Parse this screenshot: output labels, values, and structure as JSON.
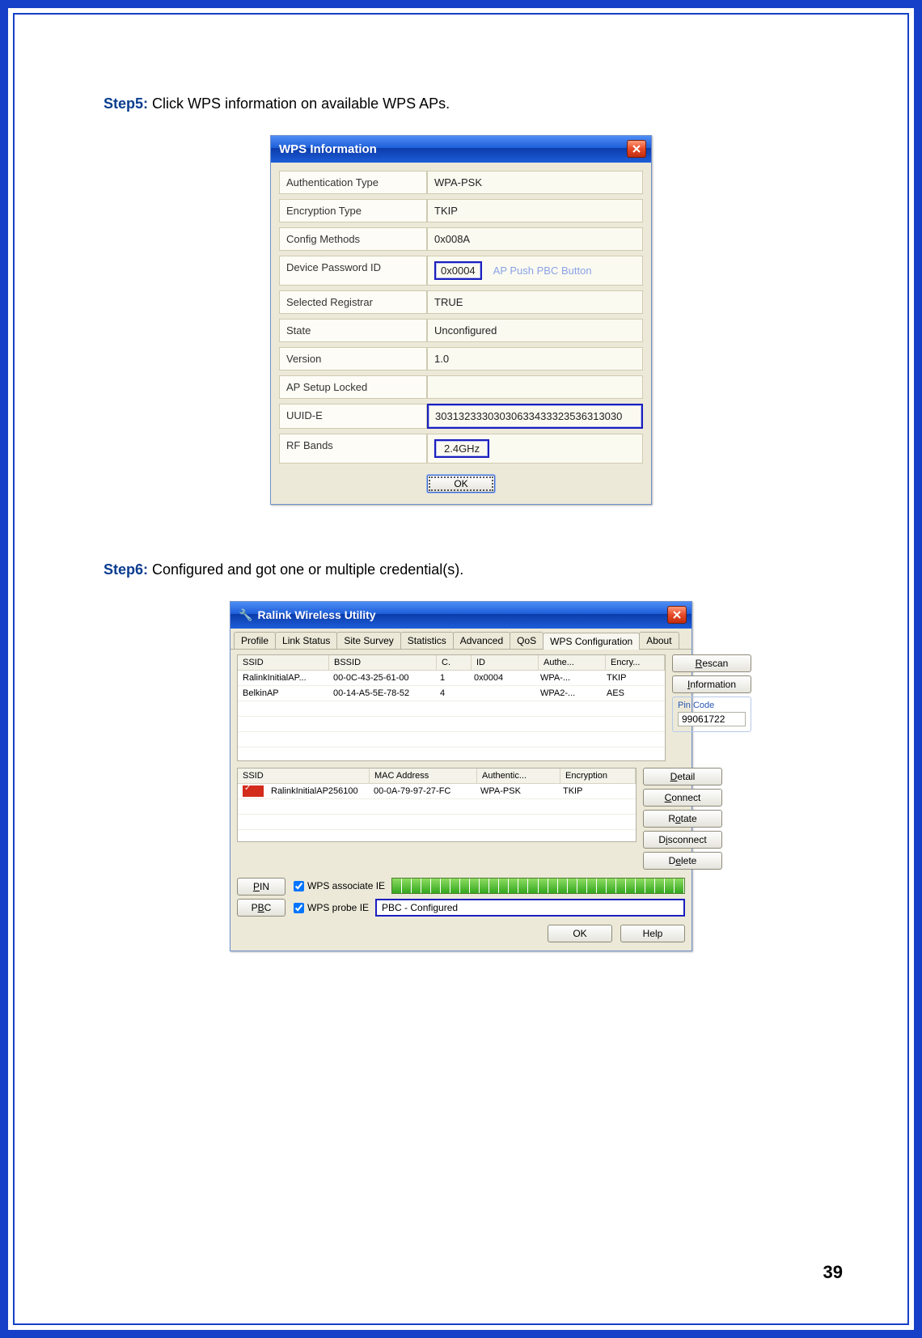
{
  "page_number": "39",
  "step5": {
    "label": "Step5:",
    "text": " Click WPS information on available WPS APs."
  },
  "step6": {
    "label": "Step6:",
    "text": " Configured and got one or multiple credential(s)."
  },
  "dlg1": {
    "title": "WPS Information",
    "rows": [
      {
        "label": "Authentication Type",
        "value": "WPA-PSK"
      },
      {
        "label": "Encryption Type",
        "value": "TKIP"
      },
      {
        "label": "Config Methods",
        "value": "0x008A"
      },
      {
        "label": "Device Password ID",
        "value": "0x0004",
        "hint": "AP Push PBC Button",
        "hl": true
      },
      {
        "label": "Selected Registrar",
        "value": "TRUE"
      },
      {
        "label": "State",
        "value": "Unconfigured"
      },
      {
        "label": "Version",
        "value": "1.0"
      },
      {
        "label": "AP Setup Locked",
        "value": ""
      },
      {
        "label": "UUID-E",
        "value": "30313233303030633433323536313030",
        "hl": true
      },
      {
        "label": "RF Bands",
        "value": "2.4GHz",
        "hl": true
      }
    ],
    "ok": "OK"
  },
  "dlg2": {
    "title": "Ralink Wireless Utility",
    "tabs": [
      "Profile",
      "Link Status",
      "Site Survey",
      "Statistics",
      "Advanced",
      "QoS",
      "WPS Configuration",
      "About"
    ],
    "active_tab": 6,
    "table1": {
      "headers": [
        "SSID",
        "BSSID",
        "C.",
        "ID",
        "Authe...",
        "Encry..."
      ],
      "rows": [
        {
          "ssid": "RalinkInitialAP...",
          "bssid": "00-0C-43-25-61-00",
          "c": "1",
          "id": "0x0004",
          "auth": "WPA-...",
          "enc": "TKIP"
        },
        {
          "ssid": "BelkinAP",
          "bssid": "00-14-A5-5E-78-52",
          "c": "4",
          "id": "",
          "auth": "WPA2-...",
          "enc": "AES"
        }
      ]
    },
    "table2": {
      "headers": [
        "SSID",
        "MAC Address",
        "Authentic...",
        "Encryption"
      ],
      "rows": [
        {
          "ssid": "RalinkInitialAP256100",
          "mac": "00-0A-79-97-27-FC",
          "auth": "WPA-PSK",
          "enc": "TKIP"
        }
      ]
    },
    "side": {
      "rescan": "Rescan",
      "info": "Information",
      "pin_label": "Pin Code",
      "pin_value": "99061722",
      "detail": "Detail",
      "connect": "Connect",
      "rotate": "Rotate",
      "disconnect": "Disconnect",
      "delete": "Delete"
    },
    "pin_btn": "PIN",
    "pbc_btn": "PBC",
    "assoc": "WPS associate IE",
    "probe": "WPS probe IE",
    "status": "PBC - Configured",
    "ok": "OK",
    "help": "Help"
  }
}
